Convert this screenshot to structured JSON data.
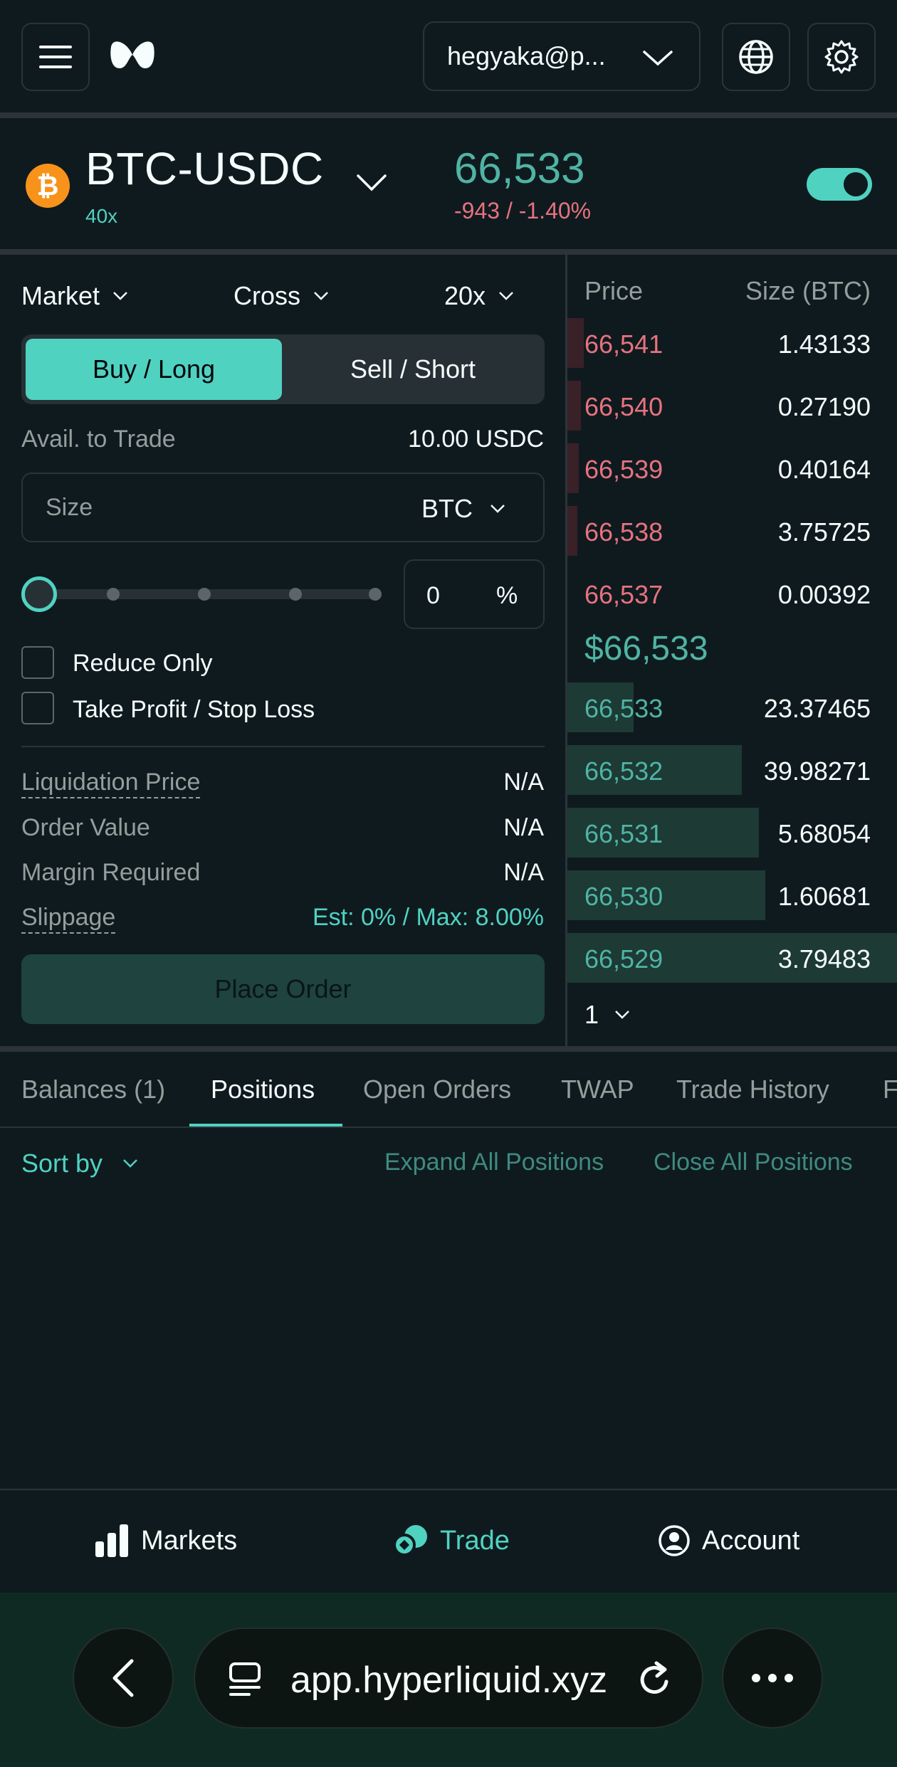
{
  "topbar": {
    "account": "hegyaka@p...",
    "menu_icon": "hamburger-icon",
    "logo_icon": "hyperliquid-logo",
    "globe_icon": "globe-icon",
    "settings_icon": "gear-icon"
  },
  "market": {
    "pair": "BTC-USDC",
    "leverage_tag": "40x",
    "price": "66,533",
    "change": "-943 / -1.40%",
    "coin_icon": "bitcoin-icon"
  },
  "order": {
    "type": "Market",
    "margin_mode": "Cross",
    "leverage": "20x",
    "buy_label": "Buy / Long",
    "sell_label": "Sell / Short",
    "avail_label": "Avail. to Trade",
    "avail_value": "10.00 USDC",
    "size_placeholder": "Size",
    "size_unit": "BTC",
    "slider_value": "0",
    "percent_sign": "%",
    "slider_fraction": 0,
    "reduce_only": "Reduce Only",
    "tp_sl": "Take Profit / Stop Loss",
    "liq_label": "Liquidation Price",
    "liq_value": "N/A",
    "order_value_label": "Order Value",
    "order_value": "N/A",
    "margin_label": "Margin Required",
    "margin_value": "N/A",
    "slippage_label": "Slippage",
    "slippage_value": "Est: 0% / Max: 8.00%",
    "place_order": "Place Order"
  },
  "orderbook": {
    "price_header": "Price",
    "size_header": "Size (BTC)",
    "mid_price": "$66,533",
    "grouping": "1",
    "asks": [
      {
        "price": "66,541",
        "size": "1.43133",
        "depth": 0.05
      },
      {
        "price": "66,540",
        "size": "0.27190",
        "depth": 0.04
      },
      {
        "price": "66,539",
        "size": "0.40164",
        "depth": 0.035
      },
      {
        "price": "66,538",
        "size": "3.75725",
        "depth": 0.03
      },
      {
        "price": "66,537",
        "size": "0.00392",
        "depth": 0.0
      }
    ],
    "bids": [
      {
        "price": "66,533",
        "size": "23.37465",
        "depth": 0.2
      },
      {
        "price": "66,532",
        "size": "39.98271",
        "depth": 0.53
      },
      {
        "price": "66,531",
        "size": "5.68054",
        "depth": 0.58
      },
      {
        "price": "66,530",
        "size": "1.60681",
        "depth": 0.6
      },
      {
        "price": "66,529",
        "size": "3.79483",
        "depth": 1.0
      }
    ]
  },
  "tabs": [
    "Balances (1)",
    "Positions",
    "Open Orders",
    "TWAP",
    "Trade History",
    "F"
  ],
  "positions": {
    "sort_by": "Sort by",
    "expand_all": "Expand All Positions",
    "close_all": "Close All Positions"
  },
  "bottom_nav": {
    "markets": "Markets",
    "trade": "Trade",
    "account": "Account"
  },
  "browser": {
    "url": "app.hyperliquid.xyz"
  },
  "colors": {
    "accent": "#50d2c1",
    "ask": "#e6737f",
    "bid": "#4fb4a4",
    "background": "#0f1a1f"
  }
}
